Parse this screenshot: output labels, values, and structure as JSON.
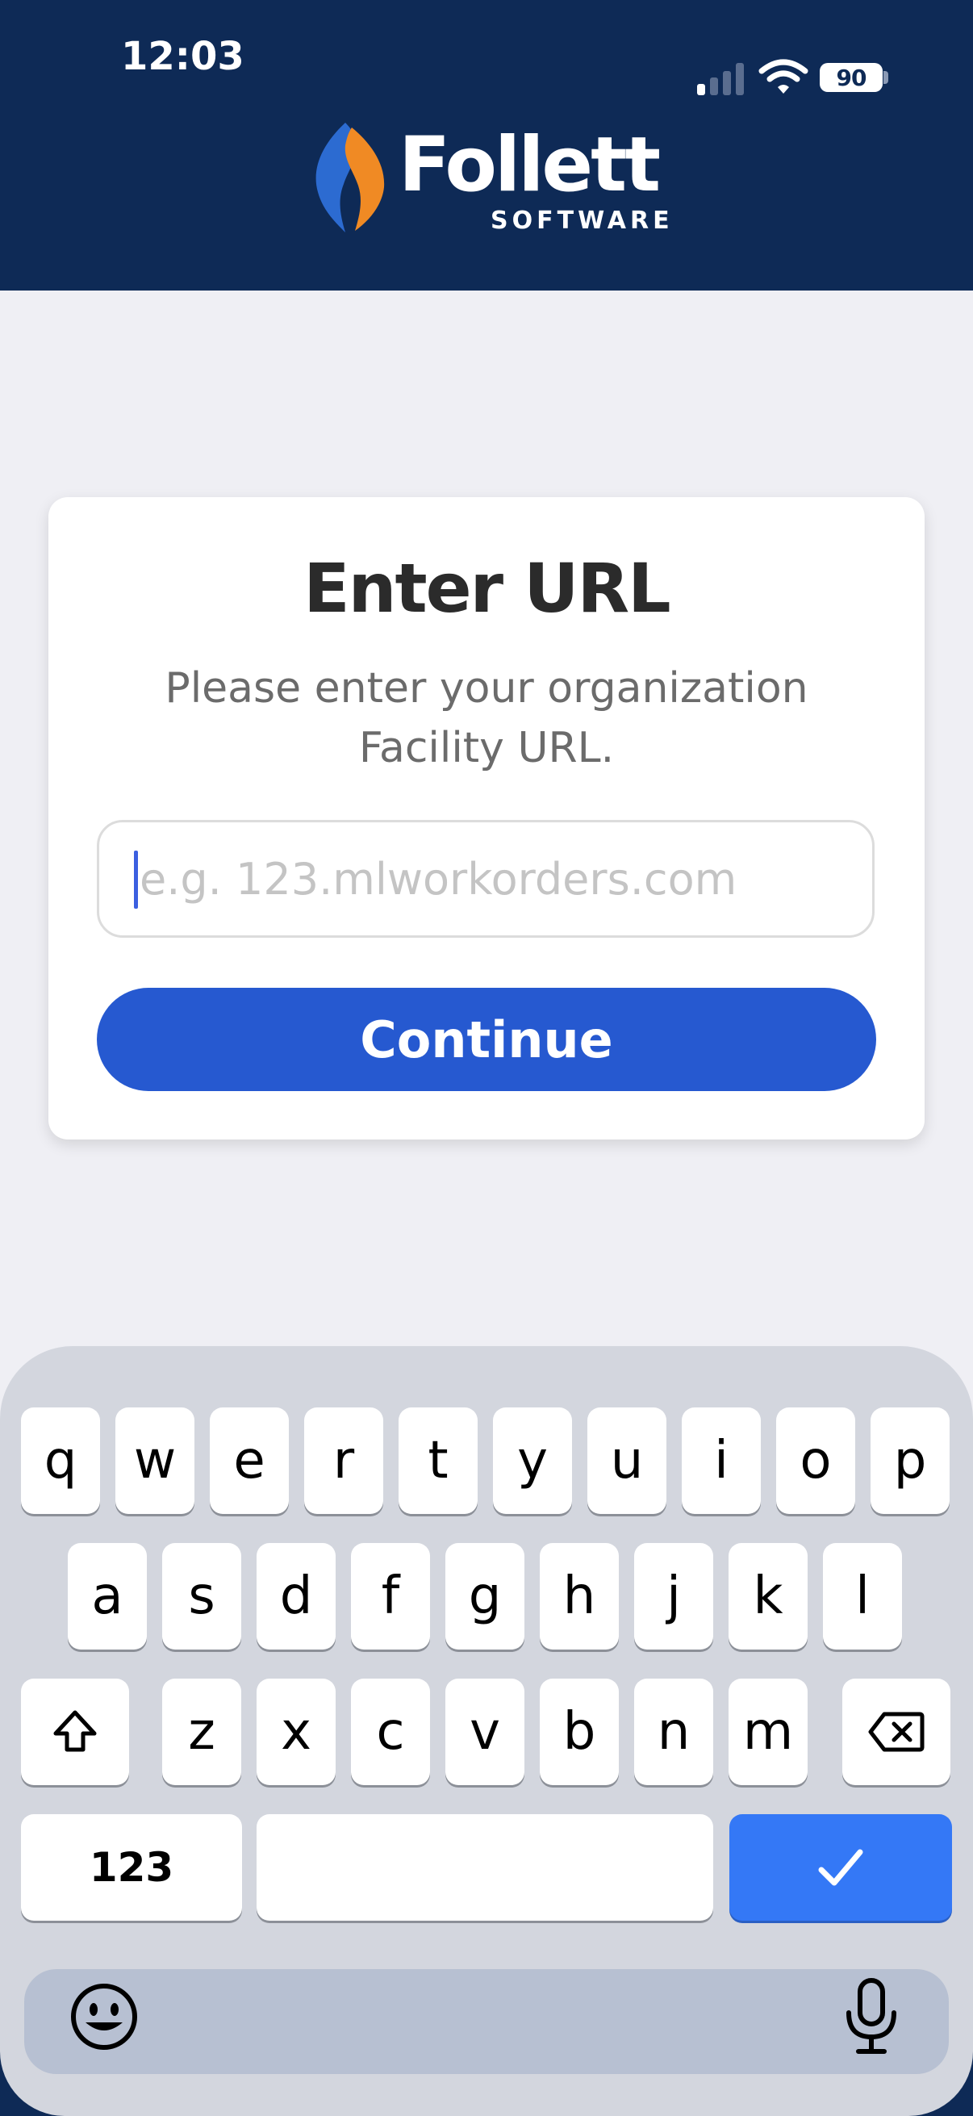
{
  "status_bar": {
    "time": "12:03",
    "battery": "90",
    "icons": [
      "signal-icon",
      "wifi-icon",
      "battery-icon"
    ]
  },
  "header": {
    "logo_word": "Follett",
    "logo_sub": "SOFTWARE",
    "background": "#0e2a56"
  },
  "card": {
    "title": "Enter URL",
    "description": "Please enter your organization Facility URL.",
    "url_placeholder": "e.g. 123.mlworkorders.com",
    "url_value": "",
    "continue_label": "Continue",
    "button_color": "#2659d0"
  },
  "keyboard": {
    "row1": [
      "q",
      "w",
      "e",
      "r",
      "t",
      "y",
      "u",
      "i",
      "o",
      "p"
    ],
    "row2": [
      "a",
      "s",
      "d",
      "f",
      "g",
      "h",
      "j",
      "k",
      "l"
    ],
    "row3": [
      "z",
      "x",
      "c",
      "v",
      "b",
      "n",
      "m"
    ],
    "numbers_label": "123",
    "space_label": "",
    "done_key_color": "#3478f6",
    "icons": [
      "shift-icon",
      "backspace-icon",
      "checkmark-icon",
      "emoji-icon",
      "microphone-icon"
    ]
  }
}
